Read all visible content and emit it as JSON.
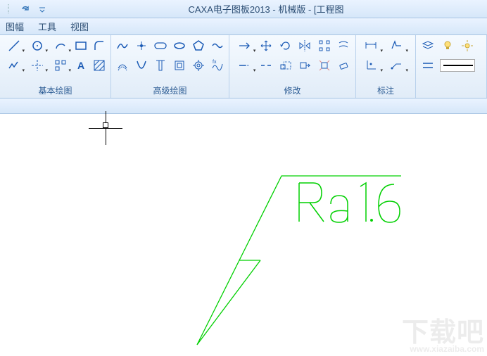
{
  "title": "CAXA电子图板2013 - 机械版 - [工程图",
  "menu": {
    "tufu": "图幅",
    "gongju": "工具",
    "shitu": "视图"
  },
  "panels": {
    "basic": {
      "title": "基本绘图"
    },
    "advanced": {
      "title": "高级绘图"
    },
    "modify": {
      "title": "修改"
    },
    "annotate": {
      "title": "标注"
    }
  },
  "watermark": {
    "line1": "下载吧",
    "line2": "www.xiazaiba.com"
  },
  "surface_value": "Ra1.6"
}
